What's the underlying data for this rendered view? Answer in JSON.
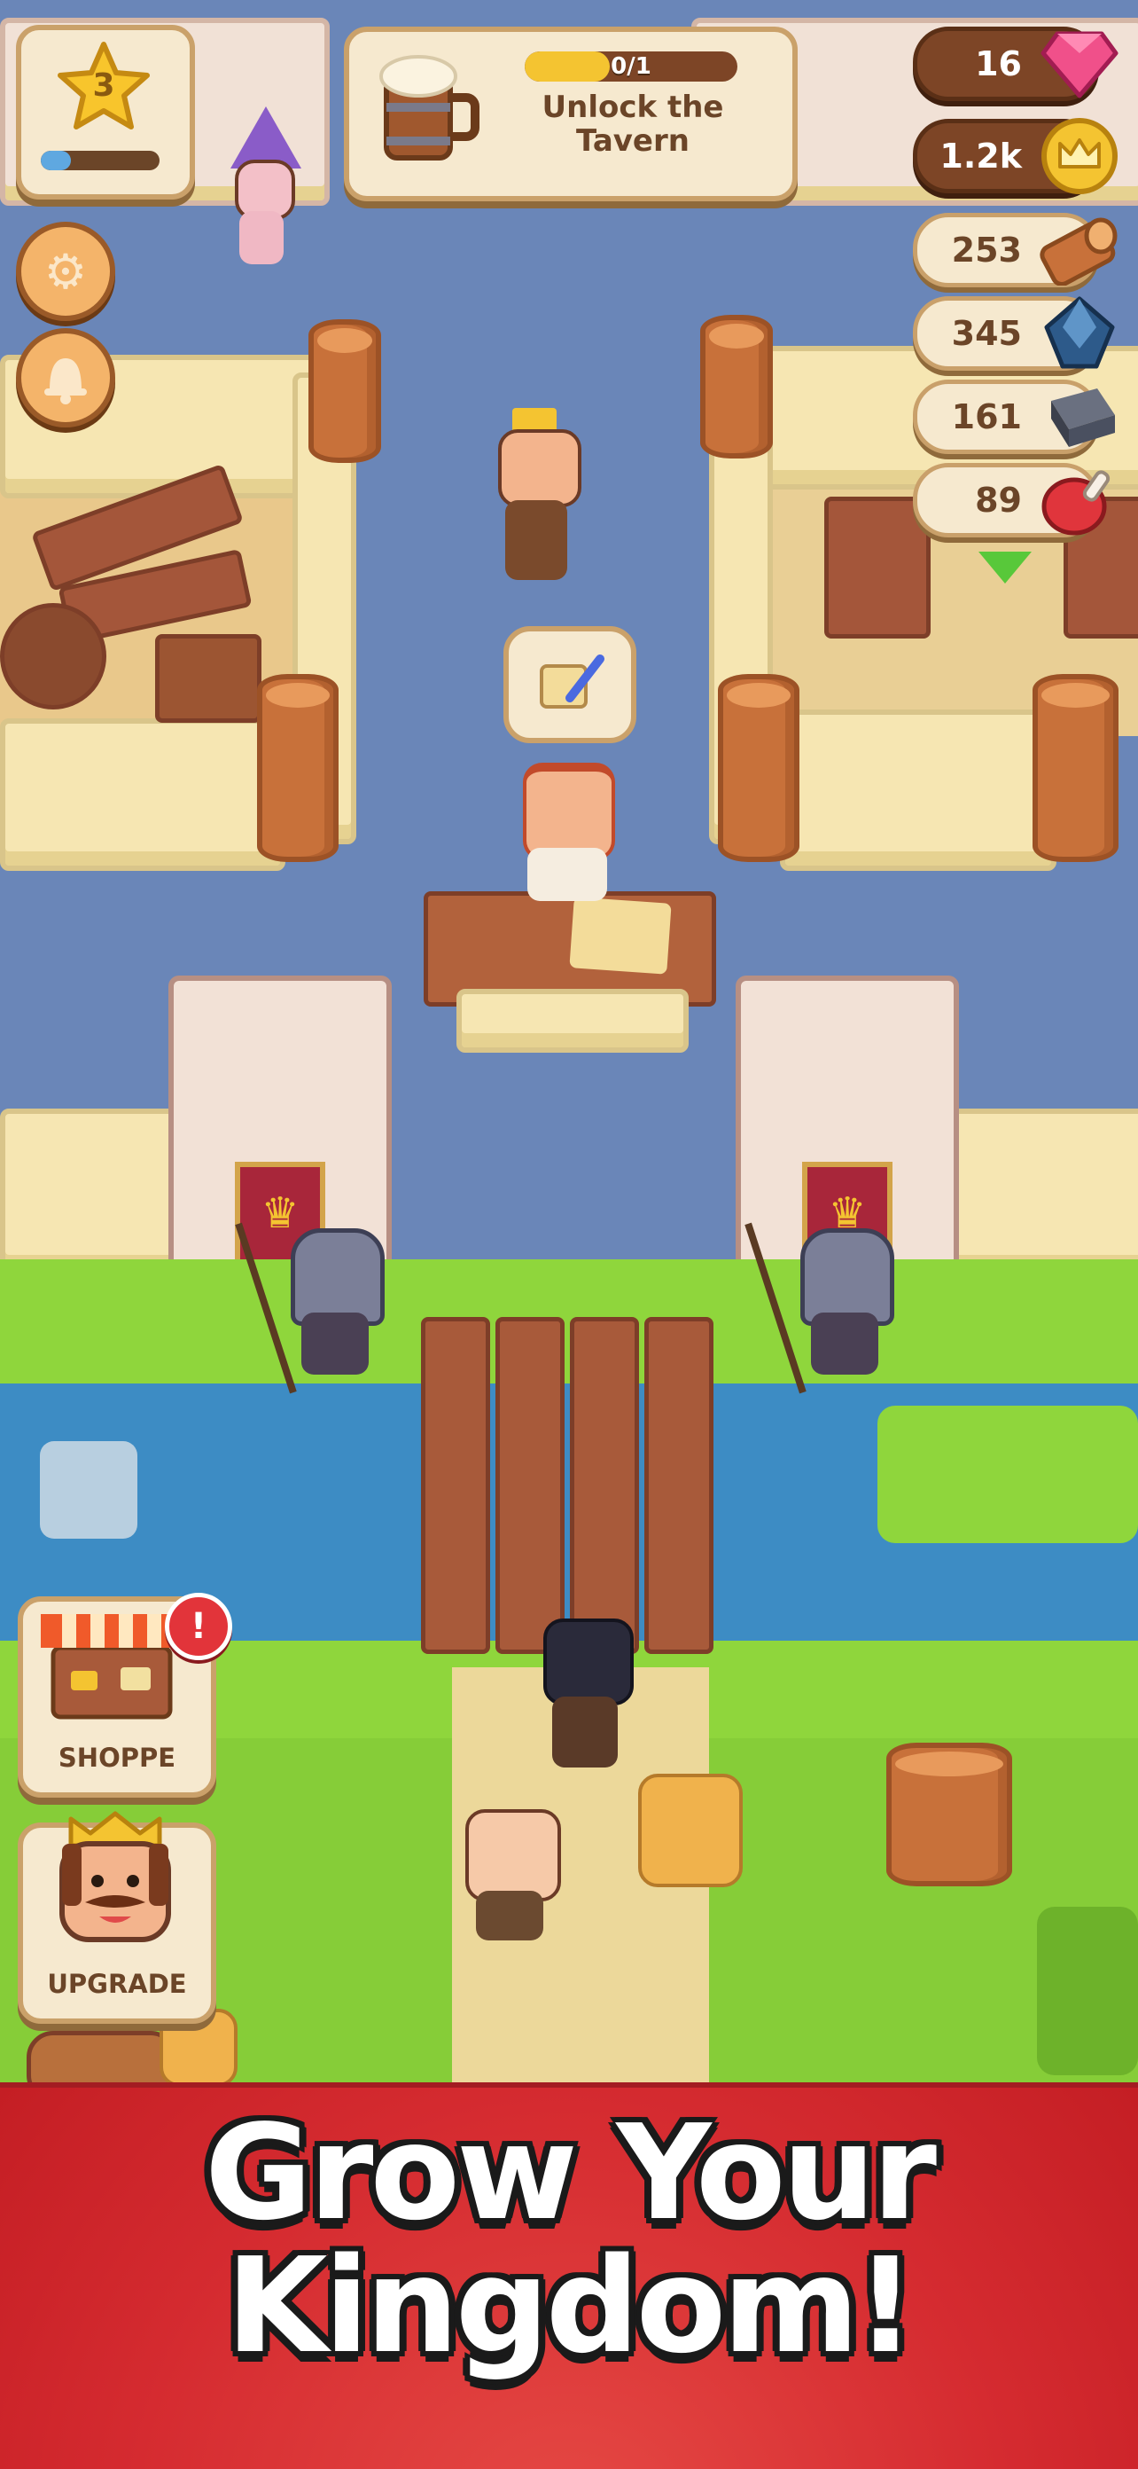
{
  "hud": {
    "level": "3",
    "level_progress": 0.25,
    "quest": {
      "progress": "0/1",
      "title": "Unlock the Tavern",
      "icon": "beer-mug-icon"
    },
    "resources": [
      {
        "name": "gems",
        "value": "16",
        "icon": "gem-icon",
        "style": "dark",
        "color": "#f0508a"
      },
      {
        "name": "crowns",
        "value": "1.2k",
        "icon": "crown-coin-icon",
        "style": "dark",
        "color": "#f4c431"
      },
      {
        "name": "wood",
        "value": "253",
        "icon": "wood-log-icon",
        "style": "light",
        "color": "#c8713a"
      },
      {
        "name": "crystal",
        "value": "345",
        "icon": "crystal-icon",
        "style": "light",
        "color": "#2d5a8a"
      },
      {
        "name": "iron",
        "value": "161",
        "icon": "iron-ingot-icon",
        "style": "light",
        "color": "#4a5060"
      },
      {
        "name": "meat",
        "value": "89",
        "icon": "meat-icon",
        "style": "light",
        "color": "#e0353c"
      }
    ],
    "settings_icon": "gear-icon",
    "notifications_icon": "bell-icon"
  },
  "side_buttons": {
    "shoppe": {
      "label": "SHOPPE",
      "icon": "shop-stall-icon",
      "alert": "!"
    },
    "upgrade": {
      "label": "UPGRADE",
      "icon": "king-portrait-icon"
    }
  },
  "speech_bubble_icon": "scroll-quill-icon",
  "tagline": {
    "line1": "Grow Your",
    "line2": "Kingdom!"
  },
  "colors": {
    "banner_red": "#d52b30",
    "grass": "#8fd63c",
    "water": "#3d8cc4",
    "road": "#6a86b8",
    "wall_cream": "#f6e6b2"
  }
}
